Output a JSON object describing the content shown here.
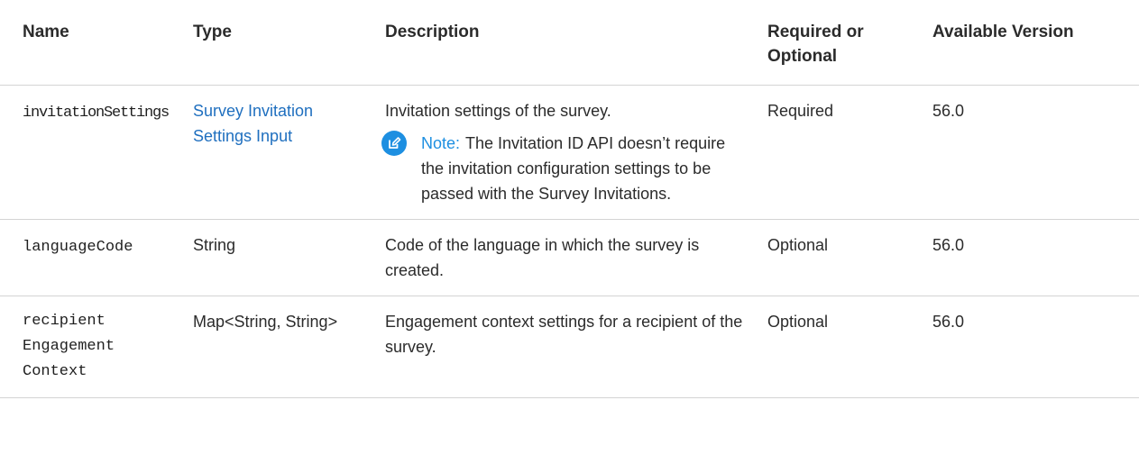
{
  "headers": {
    "name": "Name",
    "type": "Type",
    "description": "Description",
    "required": "Required or Optional",
    "version": "Available Version"
  },
  "rows": [
    {
      "name": "invitationSettings",
      "type": "Survey Invitation Settings Input",
      "description": "Invitation settings of the survey.",
      "note_label": "Note:",
      "note_text": "The Invitation ID API doesn’t require the invitation configuration settings to be passed with the Survey Invitations.",
      "required": "Required",
      "version": "56.0"
    },
    {
      "name": "languageCode",
      "type": "String",
      "description": "Code of the language in which the survey is created.",
      "required": "Optional",
      "version": "56.0"
    },
    {
      "name_lines": [
        "recipient",
        "Engagement",
        "Context"
      ],
      "type": "Map<String, String>",
      "description": "Engagement context settings for a recipient of the survey.",
      "required": "Optional",
      "version": "56.0"
    }
  ],
  "colors": {
    "link": "#1f6fbf",
    "note_accent": "#1d8fe1",
    "divider": "#d4d4d4"
  },
  "icons": {
    "note": "edit-note-icon"
  }
}
